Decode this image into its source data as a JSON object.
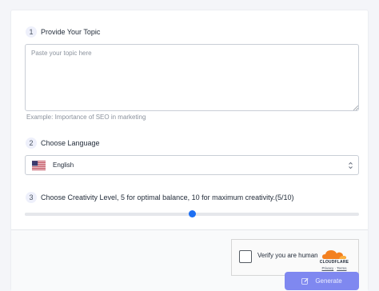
{
  "step1": {
    "number": "1",
    "title": "Provide Your Topic",
    "placeholder": "Paste your topic here",
    "value": "",
    "example": "Example:  Importance of SEO in marketing"
  },
  "step2": {
    "number": "2",
    "title": "Choose Language",
    "selected": "English",
    "flag": "us-flag-icon"
  },
  "step3": {
    "number": "3",
    "title": "Choose Creativity Level, 5 for optimal balance, 10 for maximum creativity.(5/10)",
    "value": 5,
    "min": 0,
    "max": 10
  },
  "captcha": {
    "label": "Verify you are human",
    "brand": "CLOUDFLARE",
    "privacy": "Privacy",
    "separator": "·",
    "terms": "Terms"
  },
  "generate_button": {
    "label": "Generate",
    "icon": "edit-icon"
  },
  "colors": {
    "accent": "#1d6ff2",
    "button": "#7f88f0",
    "cloudflare": "#f38020"
  }
}
